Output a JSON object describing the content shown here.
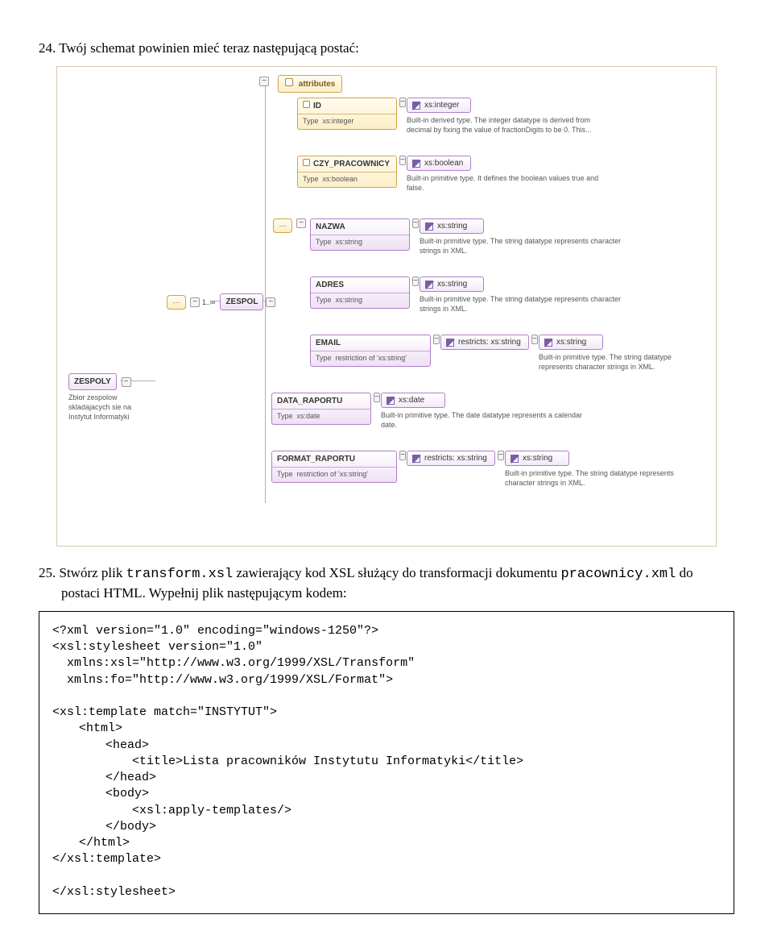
{
  "heading": "24. Twój schemat powinien mieć teraz następującą postać:",
  "para25": {
    "lead": "25. Stwórz plik ",
    "file1": "transform.xsl",
    "mid": " zawierający kod XSL służący do transformacji dokumentu ",
    "file2": "pracownicy.xml",
    "tail": " do postaci HTML. Wypełnij plik następującym kodem:"
  },
  "code": {
    "l1": "<?xml version=\"1.0\" encoding=\"windows-1250\"?>",
    "l2": "<xsl:stylesheet version=\"1.0\"",
    "l3": "  xmlns:xsl=\"http://www.w3.org/1999/XSL/Transform\"",
    "l4": "  xmlns:fo=\"http://www.w3.org/1999/XSL/Format\">",
    "l5": "<xsl:template match=\"INSTYTUT\">",
    "l6": "<html>",
    "l7": "<head>",
    "l8": "<title>Lista pracowników Instytutu Informatyki</title>",
    "l9": "</head>",
    "l10": "<body>",
    "l11": "<xsl:apply-templates/>",
    "l12": "</body>",
    "l13": "</html>",
    "l14": "</xsl:template>",
    "l15": "</xsl:stylesheet>"
  },
  "diagram": {
    "root": {
      "name": "ZESPOLY",
      "desc": "Zbior zespolow skladajacych sie na Instytut Informatyki"
    },
    "zespol": {
      "name": "ZESPOL",
      "card": "1..∞"
    },
    "attributes_label": "attributes",
    "attrs": {
      "id": {
        "name": "ID",
        "typeLabel": "Type",
        "typeVal": "xs:integer",
        "pill": "xs:integer",
        "tip": "Built-in derived type. The integer datatype is derived from decimal by fixing the value of fractionDigits to be 0. This..."
      },
      "czy": {
        "name": "CZY_PRACOWNICY",
        "typeLabel": "Type",
        "typeVal": "xs:boolean",
        "pill": "xs:boolean",
        "tip": "Built-in primitive type. It defines the boolean values true and false."
      }
    },
    "elems": {
      "nazwa": {
        "name": "NAZWA",
        "typeLabel": "Type",
        "typeVal": "xs:string",
        "pill": "xs:string",
        "tip": "Built-in primitive type. The string datatype represents character strings in XML."
      },
      "adres": {
        "name": "ADRES",
        "typeLabel": "Type",
        "typeVal": "xs:string",
        "pill": "xs:string",
        "tip": "Built-in primitive type. The string datatype represents character strings in XML."
      },
      "email": {
        "name": "EMAIL",
        "typeLabel": "Type",
        "typeVal": "restriction of 'xs:string'",
        "restrict": "restricts: xs:string",
        "pill": "xs:string",
        "tip": "Built-in primitive type. The string datatype represents character strings in XML."
      },
      "data": {
        "name": "DATA_RAPORTU",
        "typeLabel": "Type",
        "typeVal": "xs:date",
        "pill": "xs:date",
        "tip": "Built-in primitive type. The date datatype represents a calendar date."
      },
      "format": {
        "name": "FORMAT_RAPORTU",
        "typeLabel": "Type",
        "typeVal": "restriction of 'xs:string'",
        "restrict": "restricts: xs:string",
        "pill": "xs:string",
        "tip": "Built-in primitive type. The string datatype represents character strings in XML."
      }
    },
    "typeWord": "Type"
  }
}
